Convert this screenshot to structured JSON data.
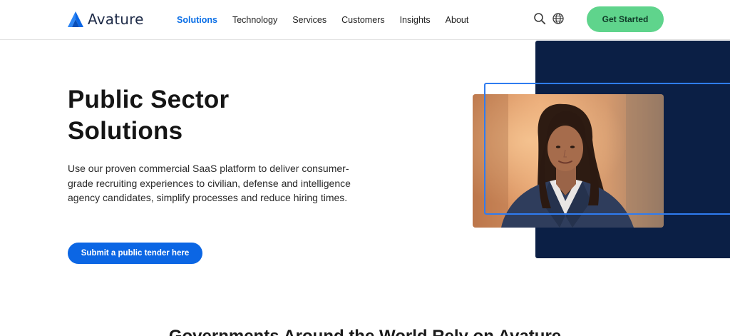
{
  "brand": {
    "name": "Avature",
    "logo_color": "#0b66e4"
  },
  "nav": {
    "items": [
      {
        "label": "Solutions",
        "active": true
      },
      {
        "label": "Technology",
        "active": false
      },
      {
        "label": "Services",
        "active": false
      },
      {
        "label": "Customers",
        "active": false
      },
      {
        "label": "Insights",
        "active": false
      },
      {
        "label": "About",
        "active": false
      }
    ],
    "active_color": "#0a6ee6"
  },
  "header_icons": {
    "search": "search-icon",
    "language": "globe-icon"
  },
  "header_cta": {
    "label": "Get Started",
    "color": "#5fd48c"
  },
  "hero": {
    "title_line1": "Public Sector",
    "title_line2": "Solutions",
    "description": "Use our proven commercial SaaS platform to deliver consumer-grade recruiting experiences to civilian, defense and intelligence agency candidates, simplify processes and reduce hiring times.",
    "button_label": "Submit a public tender here",
    "button_color": "#0b66e4"
  },
  "visual": {
    "panel_color": "#0b1f45",
    "outline_color": "#2f7cf0",
    "photo": "professional-woman-portrait"
  },
  "next_section": {
    "heading": "Governments Around the World Rely on Avature"
  }
}
